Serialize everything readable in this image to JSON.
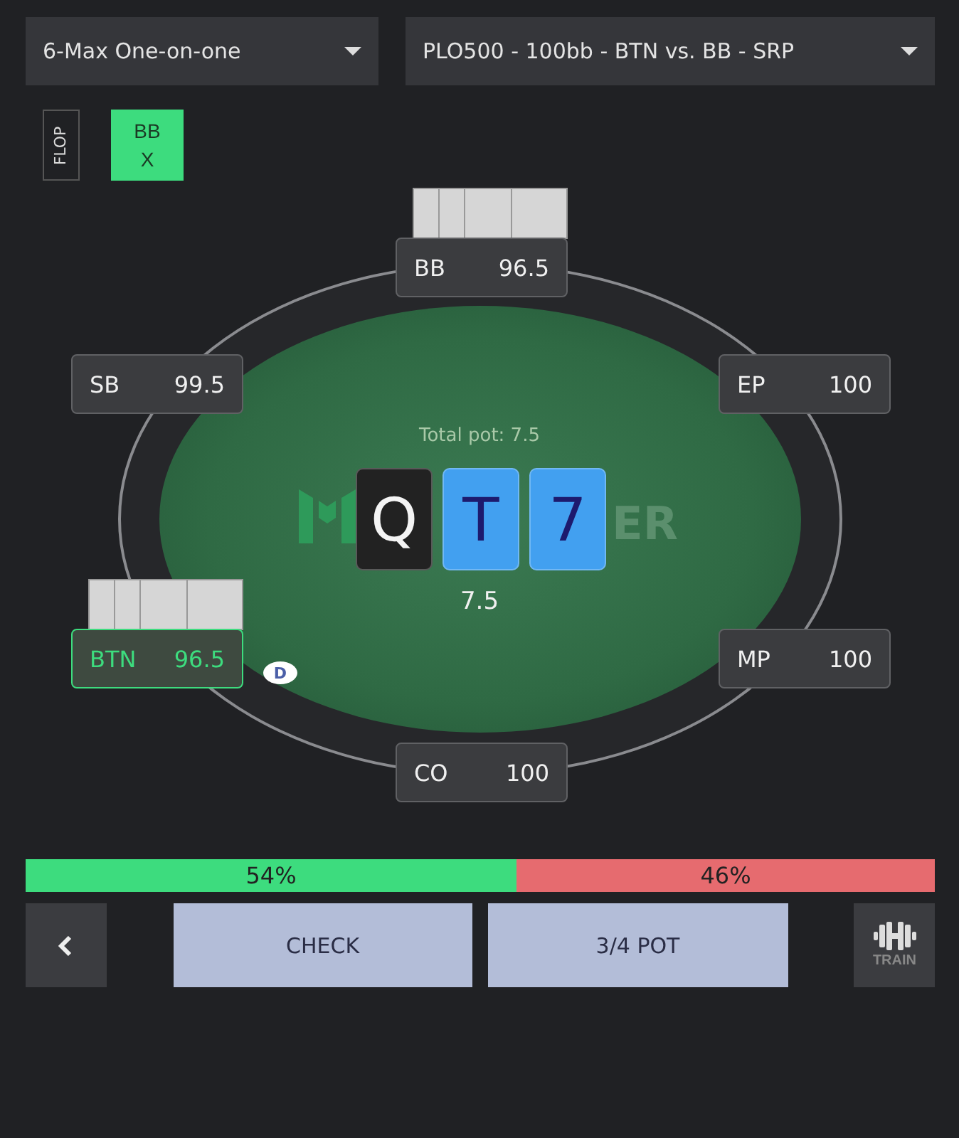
{
  "dropdowns": [
    {
      "label": "6-Max One-on-one"
    },
    {
      "label": "PLO500 - 100bb - BTN vs. BB - SRP"
    }
  ],
  "history": [
    {
      "kind": "street",
      "label": "FLOP"
    },
    {
      "kind": "action",
      "position": "BB",
      "action": "X",
      "selected": true
    }
  ],
  "table": {
    "logo_text": "ER",
    "total_pot": "Total pot: 7.5",
    "pot": "7.5",
    "dealer_text": "D",
    "board": [
      {
        "rank": "Q",
        "color": "#222222"
      },
      {
        "rank": "T",
        "color": "#42a0f0"
      },
      {
        "rank": "7",
        "color": "#42a0f0"
      }
    ],
    "seats": [
      {
        "position": "BB",
        "stack": "96.5",
        "has_cards": true,
        "active": false
      },
      {
        "position": "SB",
        "stack": "99.5",
        "has_cards": false,
        "active": false
      },
      {
        "position": "EP",
        "stack": "100",
        "has_cards": false,
        "active": false
      },
      {
        "position": "BTN",
        "stack": "96.5",
        "has_cards": true,
        "active": true
      },
      {
        "position": "MP",
        "stack": "100",
        "has_cards": false,
        "active": false
      },
      {
        "position": "CO",
        "stack": "100",
        "has_cards": false,
        "active": false
      }
    ]
  },
  "strategy": {
    "level": 0.54,
    "segments": [
      {
        "label": "54%",
        "color": "#3ddc7e"
      },
      {
        "label": "46%",
        "color": "#e66b6f"
      }
    ]
  },
  "actions": [
    "CHECK",
    "3/4 POT"
  ],
  "train": {
    "label": "TRAIN"
  }
}
